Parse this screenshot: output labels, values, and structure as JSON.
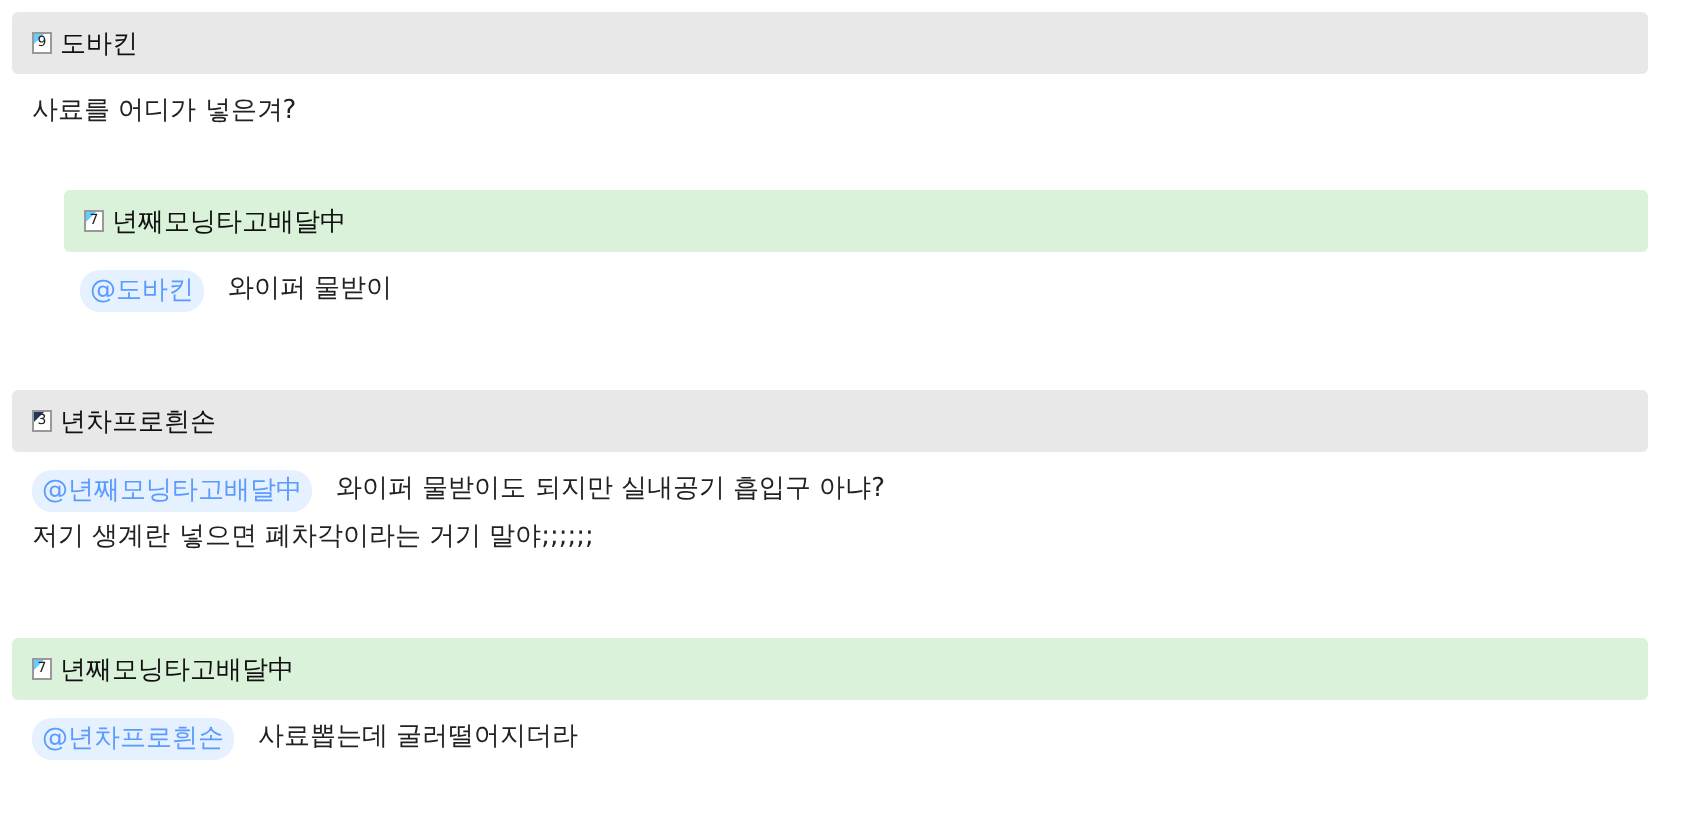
{
  "posts": [
    {
      "author": "도바킨",
      "level": "9",
      "kind": "light",
      "color": "#e8e8e8",
      "lines": [
        "사료를 어디가 넣은겨?"
      ],
      "children": [
        {
          "author": "년째모닝타고배달中",
          "level": "7",
          "kind": "light",
          "color": "#daf2d9",
          "mention": "@도바킨",
          "lines": [
            "와이퍼 물받이"
          ]
        }
      ]
    },
    {
      "author": "년차프로흰손",
      "level": "3",
      "kind": "dark",
      "color": "#e8e8e8",
      "mention": "@년째모닝타고배달中",
      "lines": [
        "와이퍼 물받이도 되지만 실내공기 흡입구 아냐?",
        "저기 생계란 넣으면 폐차각이라는 거기 말야;;;;;;"
      ]
    },
    {
      "author": "년째모닝타고배달中",
      "level": "7",
      "kind": "light",
      "color": "#daf2d9",
      "mention": "@년차프로흰손",
      "lines": [
        "사료뽑는데 굴러떨어지더라"
      ]
    }
  ]
}
